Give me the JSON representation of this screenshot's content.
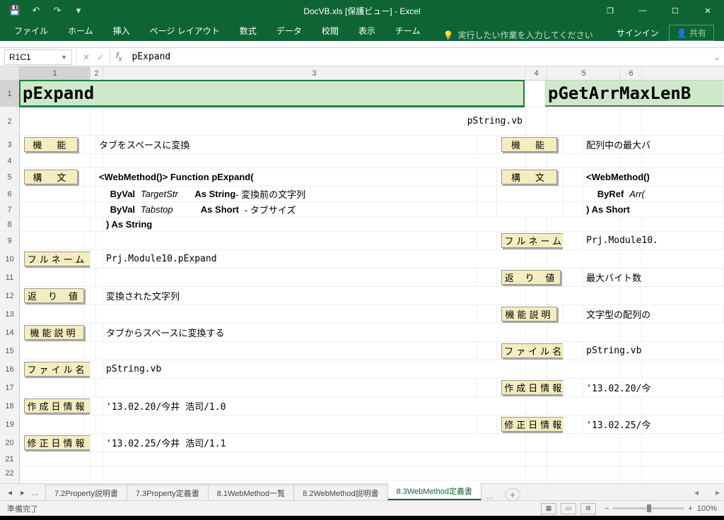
{
  "title": "DocVB.xls  [保護ビュー] - Excel",
  "qat": {
    "save": "💾",
    "undo": "↶",
    "redo": "↷",
    "dd": "▾"
  },
  "win": {
    "restore": "❐",
    "min": "—",
    "max": "☐",
    "close": "✕"
  },
  "ribbon": {
    "file": "ファイル",
    "home": "ホーム",
    "insert": "挿入",
    "page": "ページ レイアウト",
    "formula": "数式",
    "data": "データ",
    "review": "校閲",
    "view": "表示",
    "team": "チーム",
    "tell": "実行したい作業を入力してください",
    "signin": "サインイン",
    "share": "共有"
  },
  "namebox": "R1C1",
  "formula_value": "pExpand",
  "cols": {
    "1": "1",
    "2": "2",
    "3": "3",
    "4": "4",
    "5": "5",
    "6": "6"
  },
  "leftFunc": {
    "title": "pExpand",
    "file_r2": "pString.vb",
    "lbl_func": "機　能",
    "val_func": "タブをスペースに変換",
    "lbl_syn": "構　文",
    "syn1_a": "<WebMethod()> Function pExpand(",
    "syn2_byval": "ByVal",
    "syn2_arg": "TargetStr",
    "syn2_as": "As String",
    "syn2_cm": " - 変換前の文字列",
    "syn3_byval": "ByVal",
    "syn3_arg": "Tabstop",
    "syn3_as": "As Short",
    "syn3_cm": " - タブサイズ",
    "syn4": ") As String",
    "lbl_full": "フルネーム",
    "val_full": "Prj.Module10.pExpand",
    "lbl_ret": "返 り 値",
    "val_ret": "変換された文字列",
    "lbl_desc": "機能説明",
    "val_desc": "タブからスペースに変換する",
    "lbl_fname": "ファイル名",
    "val_fname": "pString.vb",
    "lbl_cdate": "作成日情報",
    "val_cdate": "'13.02.20/今井 浩司/1.0",
    "lbl_mdate": "修正日情報",
    "val_mdate": "'13.02.25/今井 浩司/1.1"
  },
  "rightFunc": {
    "title": "pGetArrMaxLenB",
    "lbl_func": "機　能",
    "val_func": "配列中の最大バ",
    "lbl_syn": "構　文",
    "syn1": "<WebMethod()",
    "syn2_byref": "ByRef",
    "syn2_arg": "Arr(",
    "syn3": ") As Short",
    "lbl_full": "フルネーム",
    "val_full": "Prj.Module10.",
    "lbl_ret": "返 り 値",
    "val_ret": "最大バイト数",
    "lbl_desc": "機能説明",
    "val_desc": "文字型の配列の",
    "lbl_fname": "ファイル名",
    "val_fname": "pString.vb",
    "lbl_cdate": "作成日情報",
    "val_cdate": "'13.02.20/今",
    "lbl_mdate": "修正日情報",
    "val_mdate": "'13.02.25/今"
  },
  "sheets": {
    "s1": "7.2Property説明書",
    "s2": "7.3Property定義書",
    "s3": "8.1WebMethod一覧",
    "s4": "8.2WebMethod説明書",
    "s5": "8.3WebMethod定義書",
    "more": "..."
  },
  "status": {
    "ready": "準備完了",
    "zoom": "100%"
  }
}
